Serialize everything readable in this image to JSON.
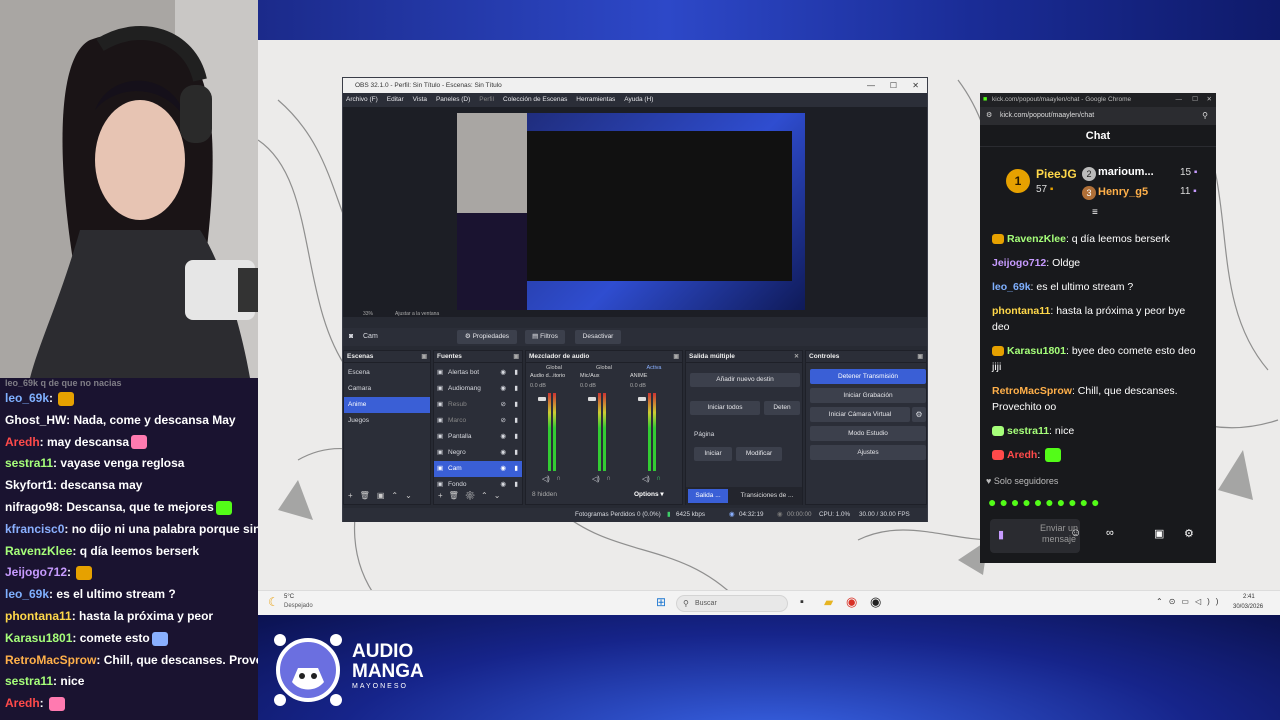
{
  "left_chat": {
    "partial_top": "leo_69k  q de que no nacias",
    "rows": [
      {
        "user": "leo_69k",
        "color": "#7fb0ff",
        "text": ""
      },
      {
        "user": "Ghost_HW",
        "color": "#ffffff",
        "text": "Nada, come y descansa May"
      },
      {
        "user": "Aredh",
        "color": "#ff4a4a",
        "text": "may descansa"
      },
      {
        "user": "sestra11",
        "color": "#a6ff7a",
        "text": "vayase venga reglosa"
      },
      {
        "user": "Skyfort1",
        "color": "#ffffff",
        "text": "descansa may"
      },
      {
        "user": "nifrago98",
        "color": "#ffffff",
        "text": "Descansa, que te mejores"
      },
      {
        "user": "kfrancisc0",
        "color": "#8ab0ff",
        "text": "no dijo ni una palabra porque sino l"
      },
      {
        "user": "RavenzKlee",
        "color": "#a6ff7a",
        "text": "q día leemos berserk"
      },
      {
        "user": "Jeijogo712",
        "color": "#c79bff",
        "text": ""
      },
      {
        "user": "leo_69k",
        "color": "#7fb0ff",
        "text": "es el ultimo stream ?"
      },
      {
        "user": "phontana11",
        "color": "#ffd84a",
        "text": "hasta la próxima y peor"
      },
      {
        "user": "Karasu1801",
        "color": "#a6ff7a",
        "text": "comete esto"
      },
      {
        "user": "RetroMacSprow",
        "color": "#ffb04a",
        "text": "Chill, que descanses. Provec"
      },
      {
        "user": "sestra11",
        "color": "#a6ff7a",
        "text": "nice"
      },
      {
        "user": "Aredh",
        "color": "#ff4a4a",
        "text": ""
      }
    ]
  },
  "logo": {
    "line1": "AUDIO",
    "line2": "MANGA",
    "line3": "MAYONESO"
  },
  "obs": {
    "title": "OBS 32.1.0 - Perfil: Sin Título - Escenas: Sin Título",
    "menu": [
      "Archivo (F)",
      "Editar",
      "Vista",
      "Paneles (D)",
      "Perfil",
      "Colección de Escenas",
      "Herramientas",
      "Ayuda (H)"
    ],
    "preview_zoom": "33%",
    "preview_fit": "Ajustar a la ventana",
    "source_name": "Cam",
    "btn_props": "Propiedades",
    "btn_filters": "Filtros",
    "btn_deactivate": "Desactivar",
    "scenes_title": "Escenas",
    "scenes": [
      "Escena",
      "Camara",
      "Anime",
      "Juegos"
    ],
    "sources_title": "Fuentes",
    "sources": [
      "Alertas bot",
      "Audiomang",
      "Resub",
      "Marco",
      "Pantalla",
      "Negro",
      "Cam",
      "Fondo"
    ],
    "mixer_title": "Mezclador de audio",
    "mixer_channels": [
      {
        "top": "Global",
        "name": "Audio d...itorio",
        "db": "0.0 dB"
      },
      {
        "top": "Global",
        "name": "Mic/Aux",
        "db": "0.0 dB"
      },
      {
        "top": "Activa",
        "name": "ANIME",
        "db": "0.0 dB"
      }
    ],
    "mixer_hidden": "8 hidden",
    "mixer_options": "Options",
    "multi_title": "Salida múltiple",
    "multi_add": "Añadir nuevo destin",
    "multi_start_all": "Iniciar todos",
    "multi_stop": "Deten",
    "multi_page": "Página",
    "multi_start": "Iniciar",
    "multi_modify": "Modificar",
    "controls_title": "Controles",
    "controls": [
      "Detener Transmisión",
      "Iniciar Grabación",
      "Iniciar Cámara Virtual",
      "Modo Estudio",
      "Ajustes"
    ],
    "tab_output": "Salida ...",
    "tab_transitions": "Transiciones de ...",
    "status": {
      "dropped": "Fotogramas Perdidos 0 (0.0%)",
      "kbps": "6425 kbps",
      "live_time": "04:32:19",
      "rec_time": "00:00:00",
      "cpu": "CPU: 1.0%",
      "fps": "30.00 / 30.00 FPS"
    }
  },
  "taskbar": {
    "weather_temp": "5°C",
    "weather_text": "Despejado",
    "search": "Buscar",
    "time": "2:41",
    "date": "30/03/2026"
  },
  "chrome": {
    "title": "kick.com/popout/maaylen/chat - Google Chrome",
    "url": "kick.com/popout/maaylen/chat",
    "chat_header": "Chat",
    "leaders": [
      {
        "rank": "1",
        "name": "PieeJG",
        "count": "57"
      },
      {
        "rank": "2",
        "name": "marioum...",
        "count": "15"
      },
      {
        "rank": "3",
        "name": "Henry_g5",
        "count": "11"
      }
    ],
    "messages": [
      {
        "user": "RavenzKlee",
        "color": "#a6ff7a",
        "text": "q día leemos berserk"
      },
      {
        "user": "Jeijogo712",
        "color": "#c79bff",
        "text": "Oldge"
      },
      {
        "user": "leo_69k",
        "color": "#7fb0ff",
        "text": "es el ultimo stream ?"
      },
      {
        "user": "phontana11",
        "color": "#ffd84a",
        "text": "hasta la próxima y peor bye deo"
      },
      {
        "user": "Karasu1801",
        "color": "#a6ff7a",
        "text": "byee deo comete esto deo jiji"
      },
      {
        "user": "RetroMacSprow",
        "color": "#ffb04a",
        "text": "Chill, que descanses. Provechito oo"
      },
      {
        "user": "sestra11",
        "color": "#a6ff7a",
        "text": "nice"
      },
      {
        "user": "Aredh",
        "color": "#ff4a4a",
        "text": ""
      }
    ],
    "followers_only": "Solo seguidores",
    "input_placeholder": "Enviar un mensaje"
  }
}
